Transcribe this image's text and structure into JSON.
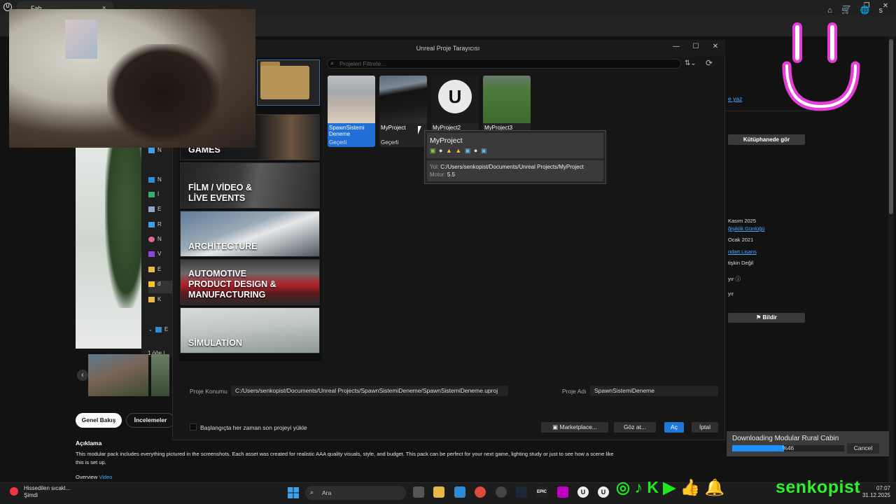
{
  "browser": {
    "tab_title": "Fab",
    "tab_close": "×",
    "window_controls": [
      "—",
      "❐",
      "✕"
    ],
    "nav_icons": "⌂ 🛒 🌐 s"
  },
  "fab_page": {
    "explorer_items": [
      "N",
      "İ",
      "E",
      "R",
      "N",
      "V",
      "E",
      "d",
      "K"
    ],
    "explorer_count": "1 öğe  |",
    "tabs": [
      "Genel Bakış",
      "İncelemeler"
    ],
    "description_title": "Açıklama",
    "description_text": "This modular pack includes everything pictured in the screenshots. Each asset was created for realistic AAA quality visuals, style, and budget. This pack can be perfect for your next game, lighting study or just to see how a scene like this is set up.",
    "overview_prefix": "Overview",
    "overview_link": "Video",
    "right_panel": {
      "write_link": "e yaz",
      "library_button": "Kütüphanede gör",
      "date1": "Kasım 2025",
      "changelog_link": "ğişiklik Günlüğü",
      "date2": "Ocak 2021",
      "license_link": "ndart Lisans",
      "line_not": "tişkin Değil",
      "line_yir1": "yır",
      "line_yir2": "yır",
      "report_button": "Bildir"
    }
  },
  "download": {
    "title": "Downloading Modular Rural Cabin",
    "percent": "%46",
    "progress": 0.46,
    "cancel": "Cancel"
  },
  "dialog": {
    "title": "Unreal Proje Tarayıcısı",
    "window_controls": [
      "—",
      "☐",
      "✕"
    ],
    "search_placeholder": "Projeleri Filtrele...",
    "categories": [
      {
        "label": "GAMES"
      },
      {
        "label": "FİLM / VİDEO &\nLİVE EVENTS"
      },
      {
        "label": "ARCHİTECTURE"
      },
      {
        "label": "AUTOMOTIVE\nPRODUCT DESIGN &\nMANUFACTURING"
      },
      {
        "label": "SİMULATİON"
      }
    ],
    "projects": [
      {
        "name": "SpawnSistemi Deneme",
        "status": "Geçerli"
      },
      {
        "name": "MyProject",
        "status": "Geçerli"
      },
      {
        "name": "MyProject2",
        "status": ""
      },
      {
        "name": "MyProject3",
        "status": ""
      }
    ],
    "tooltip": {
      "name": "MyProject",
      "platforms": "🤖  ▲ ▲ ▣ ● ▣",
      "path_label": "Yol:",
      "path": "C:/Users/senkopist/Documents/Unreal Projects/MyProject",
      "engine_label": "Motor:",
      "engine": "5.5"
    },
    "location_label": "Proje Konumu",
    "location_value": "C:/Users/senkopist/Documents/Unreal Projects/SpawnSistemiDeneme/SpawnSistemiDeneme.uproj",
    "name_label": "Proje Adı",
    "name_value": "SpawnSistemiDeneme",
    "startup_label": "Başlangıçta her zaman son projeyi yükle",
    "marketplace_button": "Marketplace...",
    "browse_button": "Göz at...",
    "open_button": "Aç",
    "cancel_button": "İptal"
  },
  "taskbar": {
    "weather_line1": "Hissedilen sıcakl...",
    "weather_line2": "Şimdi",
    "search_label": "Ara",
    "clock_time": "07:07",
    "clock_date": "31.12.2025"
  },
  "social": {
    "name": "senkopist"
  },
  "colors": {
    "accent": "#1d78d8",
    "selected_project": "#1f6fd6",
    "social_green": "#2cf22c",
    "smiley": "#e63fd8"
  }
}
